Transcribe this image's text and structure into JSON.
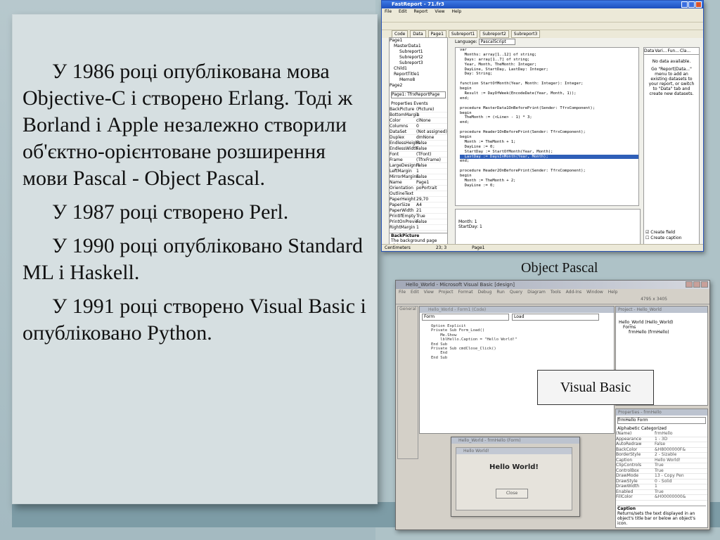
{
  "slide": {
    "paragraphs": [
      "У 1986 році опублікована мова Objective-C і створено Erlang. Тоді ж Borland і Apple незалежно створили об'єктно-орієнтоване розширення мови Pascal - Object Pascal.",
      "У 1987 році створено Perl.",
      "У 1990 році опубліковано Standard ML і Haskell.",
      "У 1991 році створено Visual Basic і опубліковано Python."
    ],
    "caption_object_pascal": "Object Pascal",
    "caption_visual_basic": "Visual Basic"
  },
  "fastreport": {
    "title": "FastReport - 71.fr3",
    "menu": [
      "File",
      "Edit",
      "Report",
      "View",
      "Help"
    ],
    "tabs": [
      "Code",
      "Data",
      "Page1",
      "Subreport1",
      "Subreport2",
      "Subreport3"
    ],
    "language_label": "Language:",
    "language_value": "PascalScript",
    "tree": [
      "Page1",
      "MasterData1",
      "Subreport1",
      "Subreport2",
      "Subreport3",
      "Child1",
      "ReportTitle1",
      "Memo8",
      "Page2"
    ],
    "object_combo": "Page1: TfrxReportPage",
    "inspector_tabs": [
      "Properties",
      "Events"
    ],
    "properties": [
      [
        "BackPicture",
        "(Picture)"
      ],
      [
        "BottomMargin",
        "1"
      ],
      [
        "Color",
        "clNone"
      ],
      [
        "Columns",
        "0"
      ],
      [
        "DataSet",
        "(Not assigned)"
      ],
      [
        "Duplex",
        "dmNone"
      ],
      [
        "EndlessHeight",
        "False"
      ],
      [
        "EndlessWidth",
        "False"
      ],
      [
        "Font",
        "(TFont)"
      ],
      [
        "Frame",
        "(TfrxFrame)"
      ],
      [
        "LargeDesignH",
        "False"
      ],
      [
        "LeftMargin",
        "1"
      ],
      [
        "MirrorMargins",
        "False"
      ],
      [
        "Name",
        "Page1"
      ],
      [
        "Orientation",
        "poPortrait"
      ],
      [
        "OutlineText",
        ""
      ],
      [
        "PaperHeight",
        "29,70"
      ],
      [
        "PaperSize",
        "A4"
      ],
      [
        "PaperWidth",
        "21"
      ],
      [
        "PrintIfEmpty",
        "True"
      ],
      [
        "PrintOnPrevio",
        "False"
      ],
      [
        "RightMargin",
        "1"
      ]
    ],
    "inspector_hint_title": "BackPicture",
    "inspector_hint_text": "The background page picture",
    "code_lines": [
      "var",
      "  Months: array[1..12] of string;",
      "  Days: array[1..7] of string;",
      "  Year, Month, TheMonth: Integer;",
      "  DayLine, StartDay, LastDay: Integer;",
      "  Day: String;",
      "",
      "function StartOfMonth(Year, Month: Integer): Integer;",
      "begin",
      "  Result := DayOfWeek(EncodeDate(Year, Month, 1));",
      "end;",
      "",
      "procedure MasterData1OnBeforePrint(Sender: TfrxComponent);",
      "begin",
      "  TheMonth := (<Line> - 1) * 3;",
      "end;",
      "",
      "procedure Header1OnBeforePrint(Sender: TfrxComponent);",
      "begin",
      "  Month := TheMonth + 1;",
      "  DayLine := 0;",
      "  StartDay := StartOfMonth(Year, Month);",
      "  LastDay := DaysInMonth(Year, Month);",
      "end;",
      "",
      "procedure Header2OnBeforePrint(Sender: TfrxComponent);",
      "begin",
      "  Month := TheMonth + 2;",
      "  DayLine := 0;"
    ],
    "highlighted_line": 22,
    "watch_lines": [
      "Month: 1",
      "StartDay: 1"
    ],
    "right_tabs": [
      "Data",
      "Vari...",
      "Fun...",
      "Cla..."
    ],
    "no_data_title": "No data available.",
    "no_data_text": "Go \"Report|Data...\" menu to add an existing datasets to your report, or switch to \"Data\" tab and create new datasets.",
    "create_field": "Create field",
    "create_caption": "Create caption",
    "status": [
      "Centimeters",
      "23; 3",
      "Page1"
    ]
  },
  "vb": {
    "title": "Hello_World - Microsoft Visual Basic [design]",
    "menu": [
      "File",
      "Edit",
      "View",
      "Project",
      "Format",
      "Debug",
      "Run",
      "Query",
      "Diagram",
      "Tools",
      "Add-Ins",
      "Window",
      "Help"
    ],
    "zoom_text": "4795 x 3405",
    "code_window_title": "Hello_World - Form1 (Code)",
    "combo_object": "Form",
    "combo_proc": "Load",
    "code_lines": [
      "Option Explicit",
      "Private Sub Form_Load()",
      "    Me.Show",
      "    lblHello.Caption = \"Hello World!\"",
      "End Sub",
      "Private Sub cmdClose_Click()",
      "    End",
      "End Sub"
    ],
    "form_designer_title": "Hello_World - frmHello (Form)",
    "hello_form_title": "Hello World!",
    "hello_label": "Hello World!",
    "close_button": "Close",
    "project_title": "Project - Hello_World",
    "project_tree": [
      "Hello_World (Hello_World)",
      "Forms",
      "frmHello (frmHello)"
    ],
    "properties_title": "Properties - frmHello",
    "properties_object": "frmHello  Form",
    "properties_tabs": [
      "Alphabetic",
      "Categorized"
    ],
    "properties": [
      [
        "(Name)",
        "frmHello"
      ],
      [
        "Appearance",
        "1 - 3D"
      ],
      [
        "AutoRedraw",
        "False"
      ],
      [
        "BackColor",
        "&H8000000F&"
      ],
      [
        "BorderStyle",
        "2 - Sizable"
      ],
      [
        "Caption",
        "Hello World!"
      ],
      [
        "ClipControls",
        "True"
      ],
      [
        "ControlBox",
        "True"
      ],
      [
        "DrawMode",
        "13 - Copy Pen"
      ],
      [
        "DrawStyle",
        "0 - Solid"
      ],
      [
        "DrawWidth",
        "1"
      ],
      [
        "Enabled",
        "True"
      ],
      [
        "FillColor",
        "&H00000000&"
      ]
    ],
    "caption_help_title": "Caption",
    "caption_help_text": "Returns/sets the text displayed in an object's title bar or below an object's icon."
  }
}
